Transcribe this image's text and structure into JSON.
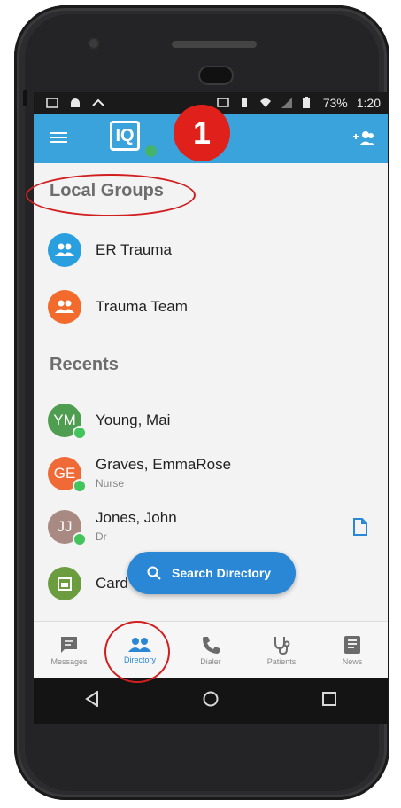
{
  "app": {
    "logo_text": "IQ",
    "badge_number": "1"
  },
  "status_bar": {
    "battery": "73%",
    "time": "1:20"
  },
  "sections": {
    "local_groups_title": "Local Groups",
    "recents_title": "Recents"
  },
  "groups": [
    {
      "name": "ER Trauma",
      "color": "#2a9fe0"
    },
    {
      "name": "Trauma Team",
      "color": "#f26a2c"
    }
  ],
  "recents": [
    {
      "initials": "YM",
      "name": "Young, Mai",
      "subtitle": "",
      "color": "#4f9d50"
    },
    {
      "initials": "GE",
      "name": "Graves, EmmaRose",
      "subtitle": "Nurse",
      "color": "#ef6a36"
    },
    {
      "initials": "JJ",
      "name": "Jones, John",
      "subtitle": "Dr",
      "color": "#a88a82"
    },
    {
      "initials": "",
      "name": "Card",
      "subtitle": "",
      "color": "#6b9d3e"
    }
  ],
  "fab": {
    "label": "Search Directory"
  },
  "bottom_nav": [
    {
      "label": "Messages",
      "icon": "message-icon",
      "active": false
    },
    {
      "label": "Directory",
      "icon": "people-icon",
      "active": true
    },
    {
      "label": "Dialer",
      "icon": "phone-icon",
      "active": false
    },
    {
      "label": "Patients",
      "icon": "stethoscope-icon",
      "active": false
    },
    {
      "label": "News",
      "icon": "news-icon",
      "active": false
    }
  ],
  "colors": {
    "accent": "#3ba3db",
    "primary_button": "#2a87d5",
    "annotation": "#d11f1f"
  }
}
